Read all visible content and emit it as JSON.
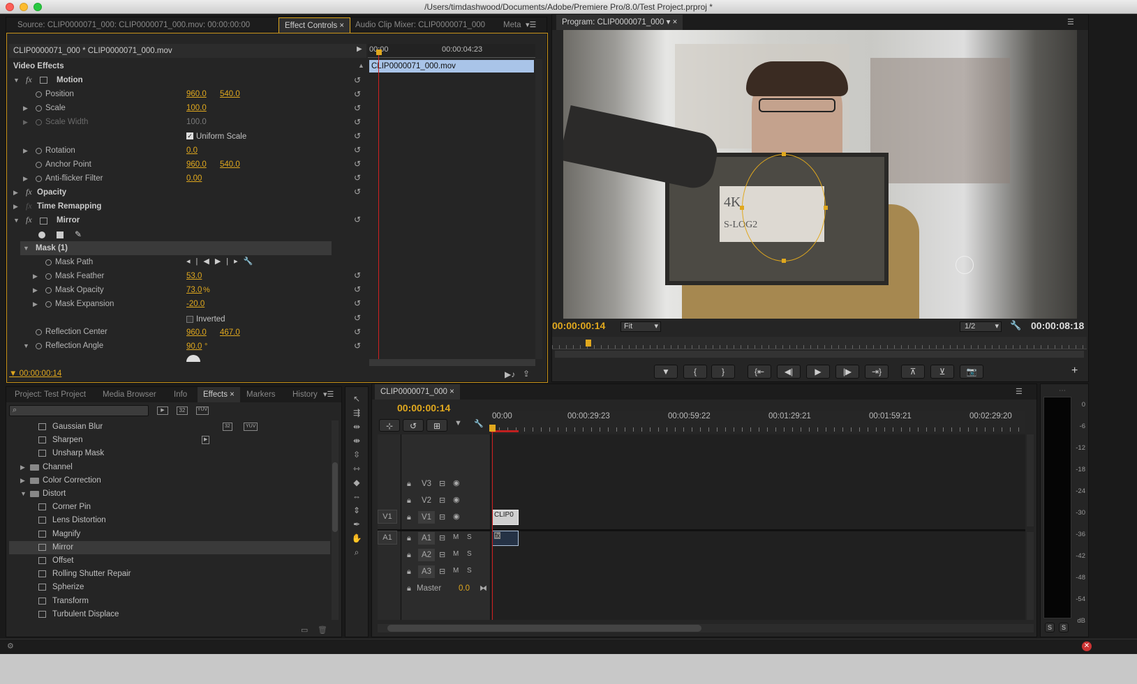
{
  "window": {
    "title": "/Users/timdashwood/Documents/Adobe/Premiere Pro/8.0/Test Project.prproj *"
  },
  "source_panel": {
    "tabs": [
      "Source: CLIP0000071_000: CLIP0000071_000.mov: 00:00:00:00",
      "Effect Controls",
      "Audio Clip Mixer: CLIP0000071_000",
      "Meta"
    ],
    "clip_header": "CLIP0000071_000 * CLIP0000071_000.mov",
    "ruler_start": "00:00",
    "ruler_mid": "00:00:04:23",
    "clip_bar": "CLIP0000071_000.mov",
    "section": "Video Effects",
    "motion": "Motion",
    "position": "Position",
    "position_x": "960.0",
    "position_y": "540.0",
    "scale": "Scale",
    "scale_val": "100.0",
    "scale_width": "Scale Width",
    "scale_width_val": "100.0",
    "uniform_scale": "Uniform Scale",
    "rotation": "Rotation",
    "rotation_val": "0.0",
    "anchor": "Anchor Point",
    "anchor_x": "960.0",
    "anchor_y": "540.0",
    "antiflicker": "Anti-flicker Filter",
    "antiflicker_val": "0.00",
    "opacity": "Opacity",
    "time_remap": "Time Remapping",
    "mirror": "Mirror",
    "mask": "Mask (1)",
    "mask_path": "Mask Path",
    "mask_feather": "Mask Feather",
    "mask_feather_val": "53.0",
    "mask_opacity": "Mask Opacity",
    "mask_opacity_val": "73.0",
    "mask_opacity_unit": "%",
    "mask_expansion": "Mask Expansion",
    "mask_expansion_val": "-20.0",
    "inverted": "Inverted",
    "refl_center": "Reflection Center",
    "refl_x": "960.0",
    "refl_y": "467.0",
    "refl_angle": "Reflection Angle",
    "refl_angle_val": "90.0",
    "refl_angle_unit": "°",
    "timecode": "00:00:00:14"
  },
  "program": {
    "tab": "Program: CLIP0000071_000",
    "timecode": "00:00:00:14",
    "fit": "Fit",
    "resolution": "1/2",
    "duration": "00:00:08:18",
    "card_text_1": "4K",
    "card_text_2": "S-LOG2"
  },
  "project_panel": {
    "tabs": [
      "Project: Test Project",
      "Media Browser",
      "Info",
      "Effects",
      "Markers",
      "History"
    ],
    "badges": [
      "32",
      "YUV"
    ],
    "items": [
      {
        "label": "Gaussian Blur",
        "indent": 2,
        "folder": false,
        "badges": [
          "32",
          "YUV"
        ]
      },
      {
        "label": "Sharpen",
        "indent": 2,
        "folder": false,
        "badges": [
          "acc"
        ]
      },
      {
        "label": "Unsharp Mask",
        "indent": 2,
        "folder": false,
        "badges": []
      },
      {
        "label": "Channel",
        "indent": 1,
        "folder": true,
        "open": false,
        "badges": []
      },
      {
        "label": "Color Correction",
        "indent": 1,
        "folder": true,
        "open": false,
        "badges": []
      },
      {
        "label": "Distort",
        "indent": 1,
        "folder": true,
        "open": true,
        "badges": []
      },
      {
        "label": "Corner Pin",
        "indent": 2,
        "folder": false,
        "badges": []
      },
      {
        "label": "Lens Distortion",
        "indent": 2,
        "folder": false,
        "badges": []
      },
      {
        "label": "Magnify",
        "indent": 2,
        "folder": false,
        "badges": []
      },
      {
        "label": "Mirror",
        "indent": 2,
        "folder": false,
        "selected": true,
        "badges": []
      },
      {
        "label": "Offset",
        "indent": 2,
        "folder": false,
        "badges": []
      },
      {
        "label": "Rolling Shutter Repair",
        "indent": 2,
        "folder": false,
        "badges": []
      },
      {
        "label": "Spherize",
        "indent": 2,
        "folder": false,
        "badges": []
      },
      {
        "label": "Transform",
        "indent": 2,
        "folder": false,
        "badges": []
      },
      {
        "label": "Turbulent Displace",
        "indent": 2,
        "folder": false,
        "badges": []
      }
    ]
  },
  "timeline": {
    "tab": "CLIP0000071_000",
    "timecode": "00:00:00:14",
    "ruler": [
      "00:00",
      "00:00:29:23",
      "00:00:59:22",
      "00:01:29:21",
      "00:01:59:21",
      "00:02:29:20"
    ],
    "video_tracks": [
      "V3",
      "V2",
      "V1"
    ],
    "audio_tracks": [
      "A1",
      "A2",
      "A3"
    ],
    "src_v": "V1",
    "src_a": "A1",
    "master": "Master",
    "master_val": "0.0",
    "clip_label": "CLIP0",
    "m": "M",
    "s": "S"
  },
  "meter": {
    "labels": [
      "0",
      "-6",
      "-12",
      "-18",
      "-24",
      "-30",
      "-36",
      "-42",
      "-48",
      "-54",
      "dB"
    ],
    "solo": "S"
  },
  "colors": {
    "accent": "#e0a81e",
    "playhead": "#d02020",
    "selection": "#a9c4e8"
  }
}
